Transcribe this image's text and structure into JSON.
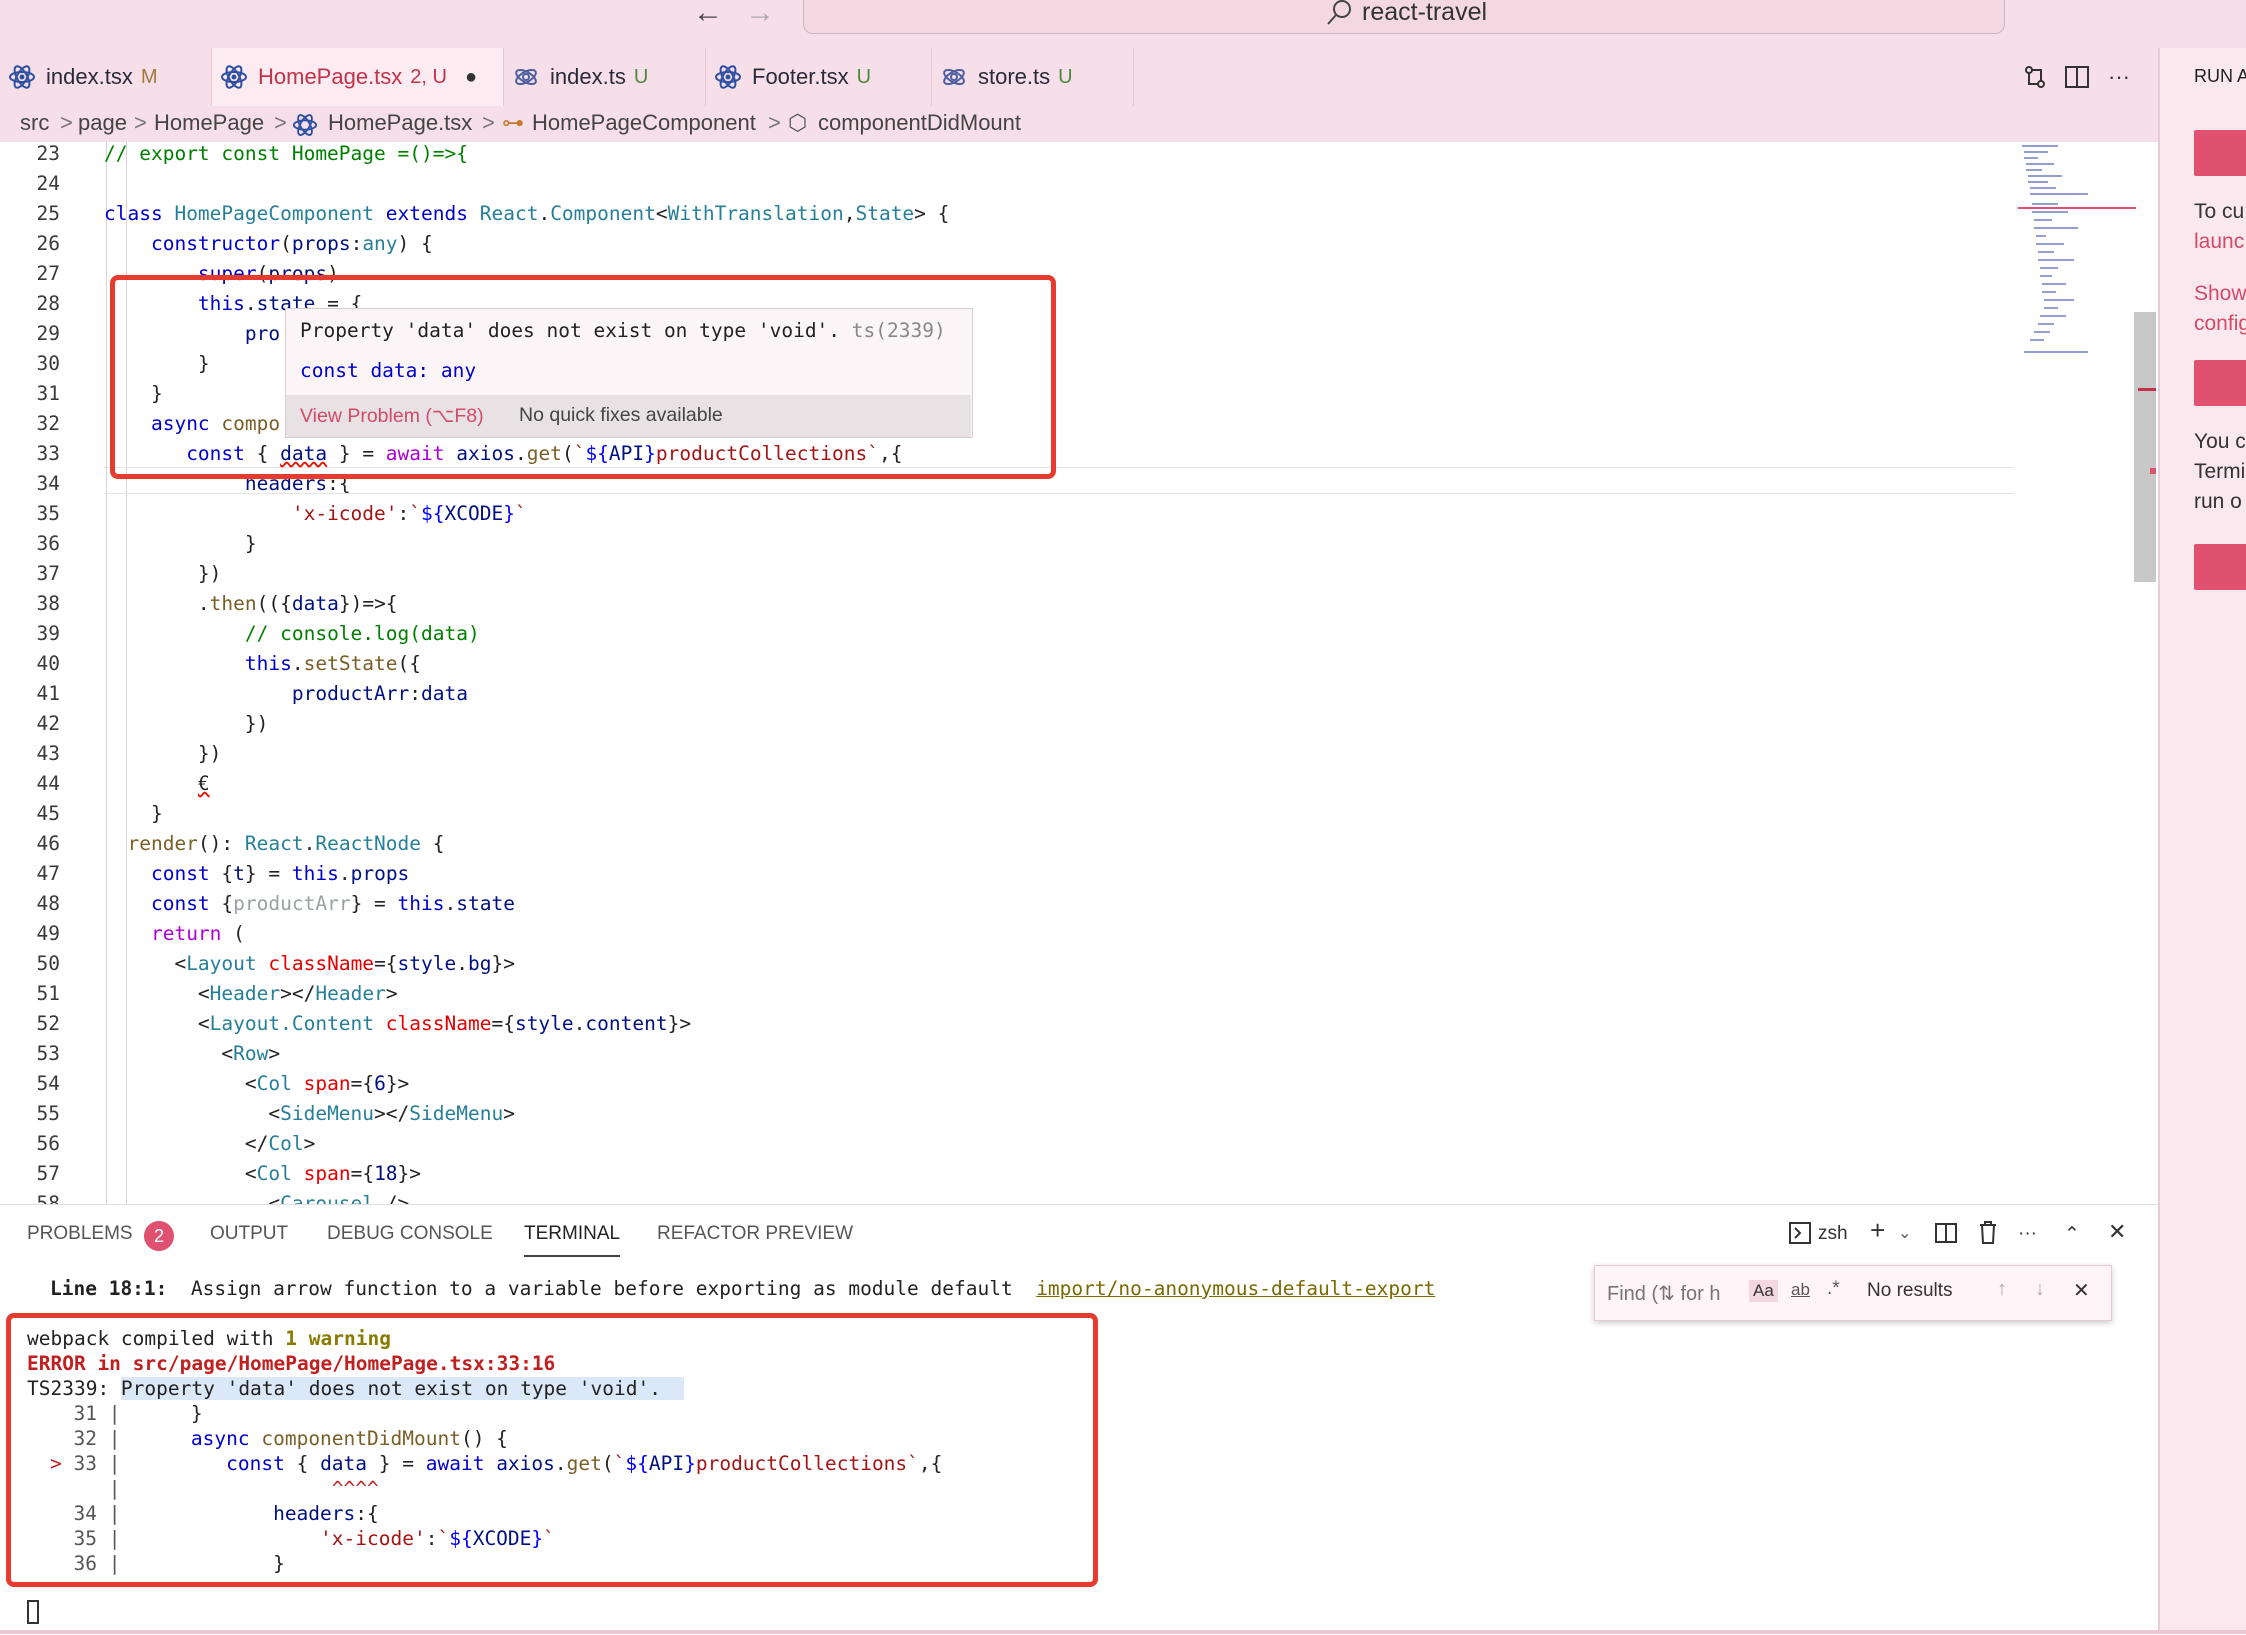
{
  "window": {
    "search_text": "react-travel",
    "back_arrow": "←",
    "forward_arrow": "→"
  },
  "tabs": [
    {
      "name": "index.tsx",
      "status": "M",
      "status_color": "#a07a3a"
    },
    {
      "name": "HomePage.tsx",
      "status": "2, U",
      "status_color": "#c2334a",
      "dirty": "●"
    },
    {
      "name": "index.ts",
      "status": "U",
      "status_color": "#4b8a3a"
    },
    {
      "name": "Footer.tsx",
      "status": "U",
      "status_color": "#4b8a3a"
    },
    {
      "name": "store.ts",
      "status": "U",
      "status_color": "#4b8a3a"
    }
  ],
  "tab_actions": {
    "more": "···"
  },
  "sidebar": {
    "title": "RUN A",
    "line1": "To cu",
    "line2": "launc",
    "line3": "Show",
    "line4": "config",
    "line5": "You c",
    "line6": "Termi",
    "line7": "run o"
  },
  "breadcrumbs": {
    "b1": "src",
    "b2": "page",
    "b3": "HomePage",
    "b4": "HomePage.tsx",
    "b5": "HomePageComponent",
    "b6": "componentDidMount",
    "sep": ">"
  },
  "editor": {
    "line_numbers": [
      "23",
      "24",
      "25",
      "26",
      "27",
      "28",
      "29",
      "30",
      "31",
      "32",
      "33",
      "34",
      "35",
      "36",
      "37",
      "38",
      "39",
      "40",
      "41",
      "42",
      "43",
      "44",
      "45",
      "46",
      "47",
      "48",
      "49",
      "50",
      "51",
      "52",
      "53",
      "54",
      "55",
      "56",
      "57",
      "58"
    ]
  },
  "hover": {
    "message": "Property 'data' does not exist on type 'void'.",
    "code": "ts(2339)",
    "type_info": "const data: any",
    "view_problem": "View Problem (⌥F8)",
    "no_fix": "No quick fixes available"
  },
  "panel": {
    "tabs": {
      "problems": "PROBLEMS",
      "problems_count": "2",
      "output": "OUTPUT",
      "debug": "DEBUG CONSOLE",
      "terminal": "TERMINAL",
      "refactor": "REFACTOR PREVIEW"
    },
    "shell": "zsh",
    "find": {
      "placeholder": "Find (⇅ for h",
      "case": "Aa",
      "word": "ab",
      "regex": ".*",
      "result": "No results"
    },
    "lint_line": {
      "location": "Line 18:1:",
      "message": "Assign arrow function to a variable before exporting as module default",
      "rule": "import/no-anonymous-default-export"
    },
    "terminal_lines": {
      "webpack_pre": "webpack compiled with ",
      "webpack_count": "1",
      "webpack_word": " warning",
      "error": "ERROR in src/page/HomePage/HomePage.tsx:33:16",
      "ts_code": "TS2339: ",
      "ts_msg": "Property 'data' does not exist on type 'void'."
    }
  },
  "colors": {
    "accent": "#e0506f",
    "titlebar": "#f6dfe8",
    "error_box": "#e63b2e"
  }
}
